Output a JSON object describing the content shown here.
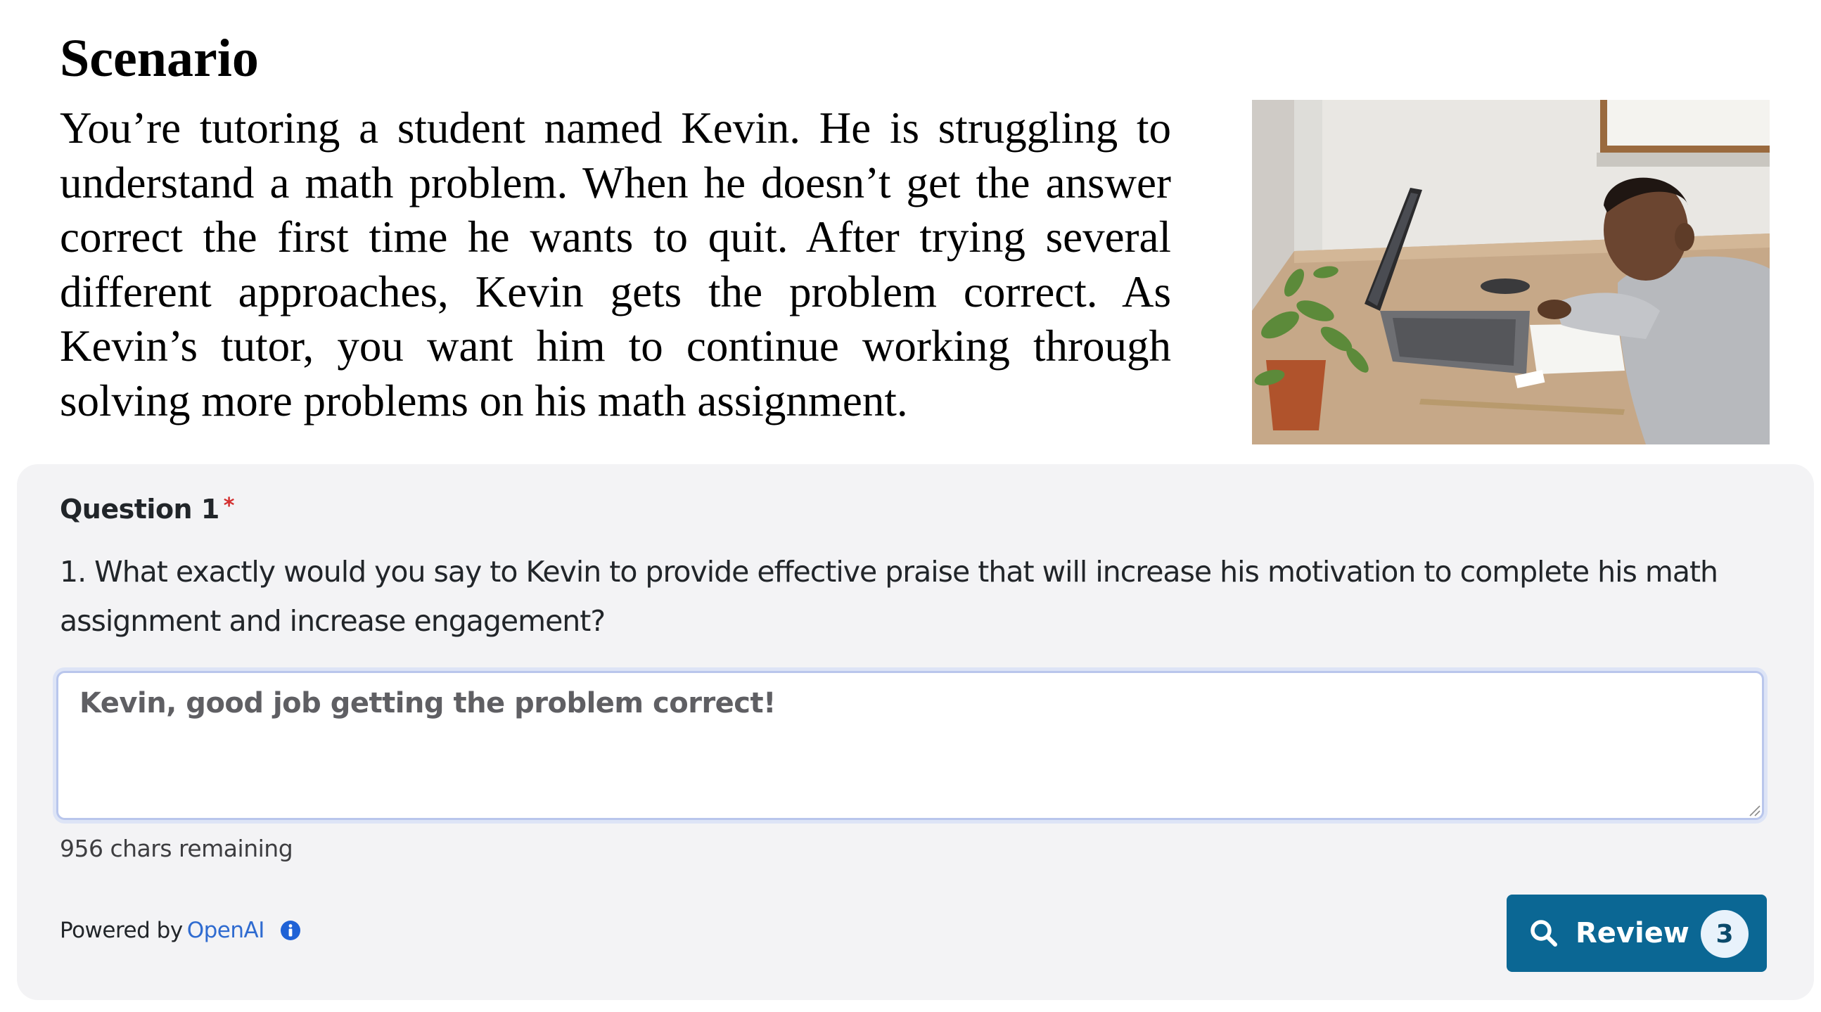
{
  "scenario": {
    "title": "Scenario",
    "text": "You’re tutoring a student named Kevin. He is struggling to understand a math problem. When he doesn’t get the answer correct the first time he wants to quit. After trying several different approaches, Kevin gets the problem correct. As Kevin’s tutor, you want him to continue working through solving more problems on his math assignment."
  },
  "question": {
    "label": "Question 1",
    "required_marker": "*",
    "text": "1. What exactly would you say to Kevin to provide effective praise that will increase his motivation to complete his math assignment and increase engagement?",
    "answer_value": "Kevin, good job getting the problem correct!",
    "chars_remaining": "956 chars remaining"
  },
  "footer": {
    "powered_by": "Powered by",
    "provider": "OpenAI",
    "info_icon": "info-icon",
    "review_icon": "search-icon",
    "review_label": "Review",
    "review_count": "3"
  },
  "colors": {
    "card_bg": "#f3f3f5",
    "button_bg": "#0b6794",
    "link": "#2f6bd0",
    "required": "#d32f2f",
    "focus_ring": "#b9c6ec"
  }
}
